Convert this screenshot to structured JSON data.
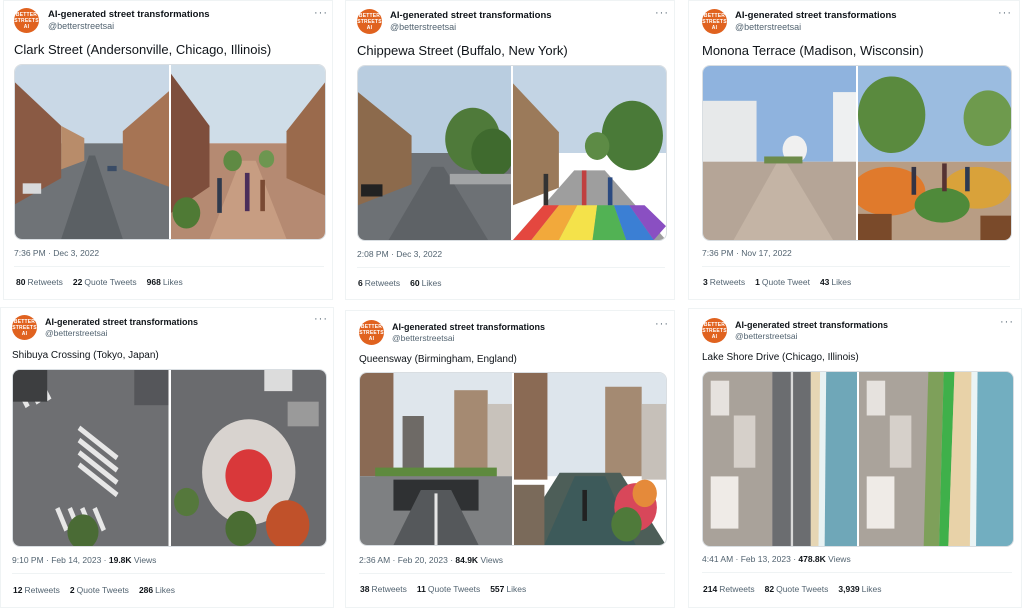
{
  "account": {
    "name": "AI-generated street transformations",
    "handle": "@betterstreetsai",
    "avatar_text": "BETTER STREETS AI",
    "brand_color": "#e0621f"
  },
  "more_icon": "more-icon",
  "tweets": [
    {
      "title": "Clark Street (Andersonville, Chicago, Illinois)",
      "time": "7:36 PM · Dec 3, 2022",
      "views": "",
      "views_label": "",
      "retweets": "80",
      "retweets_label": "Retweets",
      "quotes": "22",
      "quotes_label": "Quote Tweets",
      "likes": "968",
      "likes_label": "Likes"
    },
    {
      "title": "Chippewa Street (Buffalo, New York)",
      "time": "2:08 PM · Dec 3, 2022",
      "views": "",
      "views_label": "",
      "retweets": "6",
      "retweets_label": "Retweets",
      "quotes": "",
      "quotes_label": "",
      "likes": "60",
      "likes_label": "Likes"
    },
    {
      "title": "Monona Terrace (Madison, Wisconsin)",
      "time": "7:36 PM · Nov 17, 2022",
      "views": "",
      "views_label": "",
      "retweets": "3",
      "retweets_label": "Retweets",
      "quotes": "1",
      "quotes_label": "Quote Tweet",
      "likes": "43",
      "likes_label": "Likes"
    },
    {
      "title": "Shibuya Crossing (Tokyo, Japan)",
      "time": "9:10 PM · Feb 14, 2023 · ",
      "views": "19.8K",
      "views_label": " Views",
      "retweets": "12",
      "retweets_label": "Retweets",
      "quotes": "2",
      "quotes_label": "Quote Tweets",
      "likes": "286",
      "likes_label": "Likes"
    },
    {
      "title": "Queensway (Birmingham, England)",
      "time": "2:36 AM · Feb 20, 2023 · ",
      "views": "84.9K",
      "views_label": " Views",
      "retweets": "38",
      "retweets_label": "Retweets",
      "quotes": "11",
      "quotes_label": "Quote Tweets",
      "likes": "557",
      "likes_label": "Likes"
    },
    {
      "title": "Lake Shore Drive (Chicago, Illinois)",
      "time": "4:41 AM · Feb 13, 2023 · ",
      "views": "478.8K",
      "views_label": " Views",
      "retweets": "214",
      "retweets_label": "Retweets",
      "quotes": "82",
      "quotes_label": "Quote Tweets",
      "likes": "3,939",
      "likes_label": "Likes"
    }
  ]
}
